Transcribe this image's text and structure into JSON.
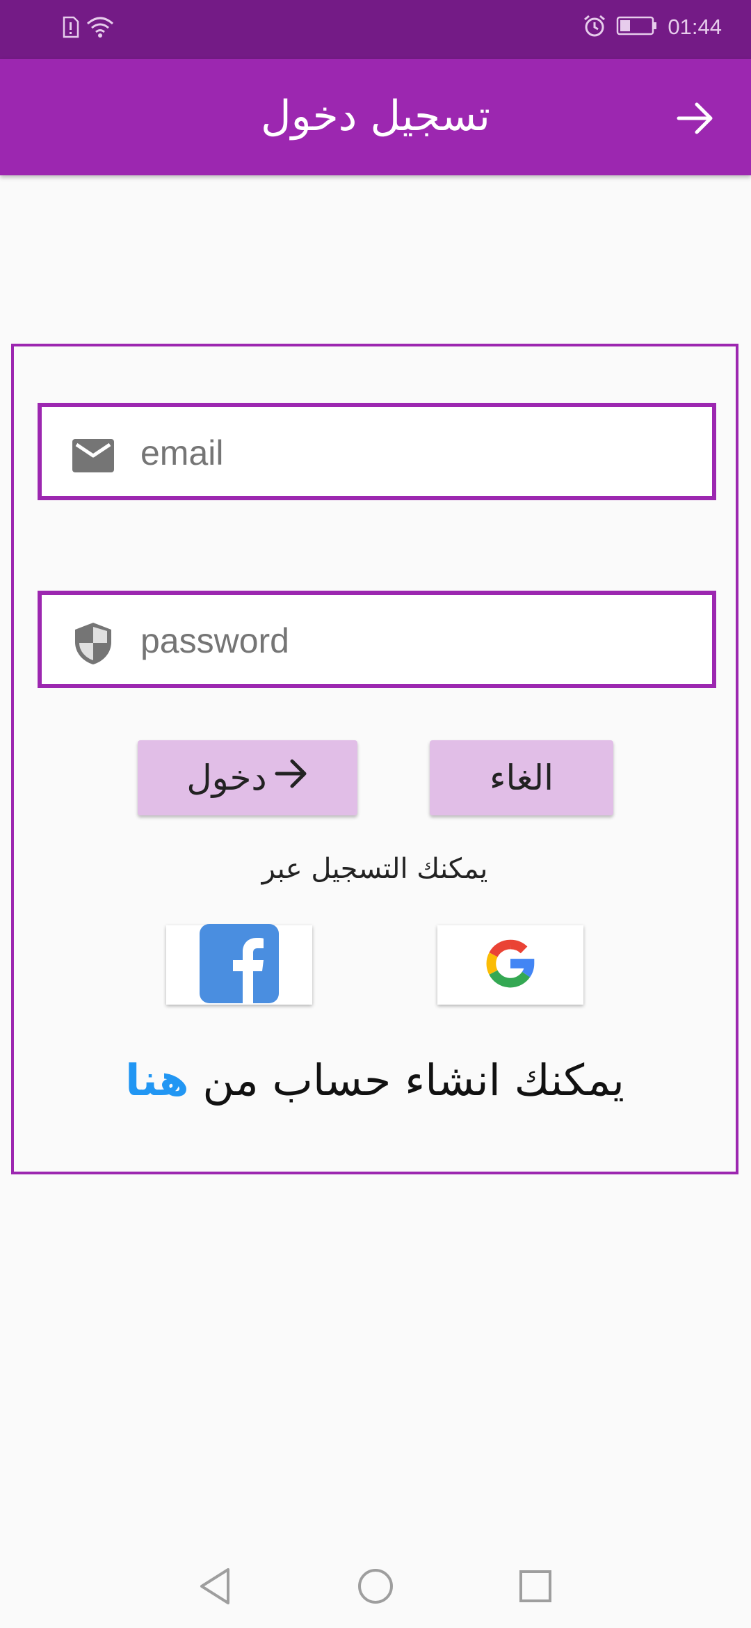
{
  "status_bar": {
    "time": "01:44"
  },
  "app_bar": {
    "title": "تسجيل دخول"
  },
  "login_form": {
    "email_placeholder": "email",
    "password_placeholder": "password",
    "login_button": "دخول",
    "cancel_button": "الغاء",
    "social_hint": "يمكنك التسجيل عبر",
    "create_account_text": "يمكنك انشاء حساب من",
    "create_account_link": "هنا"
  },
  "colors": {
    "status_bar": "#741b86",
    "primary": "#9c27b0",
    "button_bg": "#e1bee7",
    "link": "#2196f3",
    "facebook": "#4a8ee0"
  },
  "icons": {
    "status_left": [
      "sim-alert-icon",
      "wifi-icon"
    ],
    "status_right": [
      "alarm-icon",
      "battery-icon"
    ],
    "app_bar": "arrow-right-icon",
    "email": "mail-icon",
    "password": "shield-icon",
    "login": "arrow-right-icon",
    "social": [
      "facebook-icon",
      "google-icon"
    ],
    "nav": [
      "back-triangle-icon",
      "home-circle-icon",
      "recents-square-icon"
    ]
  }
}
